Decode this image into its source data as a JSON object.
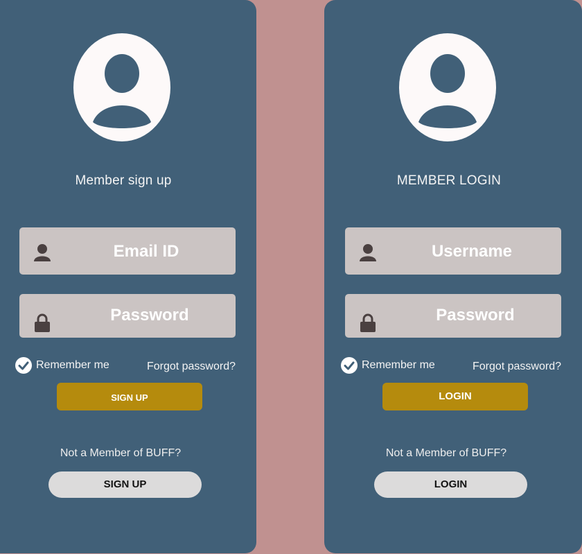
{
  "colors": {
    "page_background": "#c09190",
    "panel_background": "#416078",
    "field_background": "#cbc4c3",
    "primary_button": "#b58b0d",
    "secondary_button": "#dcdbdb",
    "icon_dark": "#4a4040",
    "avatar_fill": "#fdf9f9"
  },
  "signup": {
    "title": "Member sign up",
    "avatar_icon": "user-avatar-icon",
    "field_1": {
      "icon": "user-icon",
      "placeholder": "Email ID"
    },
    "field_2": {
      "icon": "lock-icon",
      "placeholder": "Password"
    },
    "remember_label": "Remember me",
    "remember_checked": true,
    "forgot_label": "Forgot password?",
    "primary_button_label": "SIGN UP",
    "not_member_text": "Not a Member of BUFF?",
    "secondary_button_label": "SIGN UP"
  },
  "login": {
    "title": "MEMBER LOGIN",
    "avatar_icon": "user-avatar-icon",
    "field_1": {
      "icon": "user-icon",
      "placeholder": "Username"
    },
    "field_2": {
      "icon": "lock-icon",
      "placeholder": "Password"
    },
    "remember_label": "Remember me",
    "remember_checked": true,
    "forgot_label": "Forgot password?",
    "primary_button_label": "LOGIN",
    "not_member_text": "Not a Member of BUFF?",
    "secondary_button_label": "LOGIN"
  }
}
